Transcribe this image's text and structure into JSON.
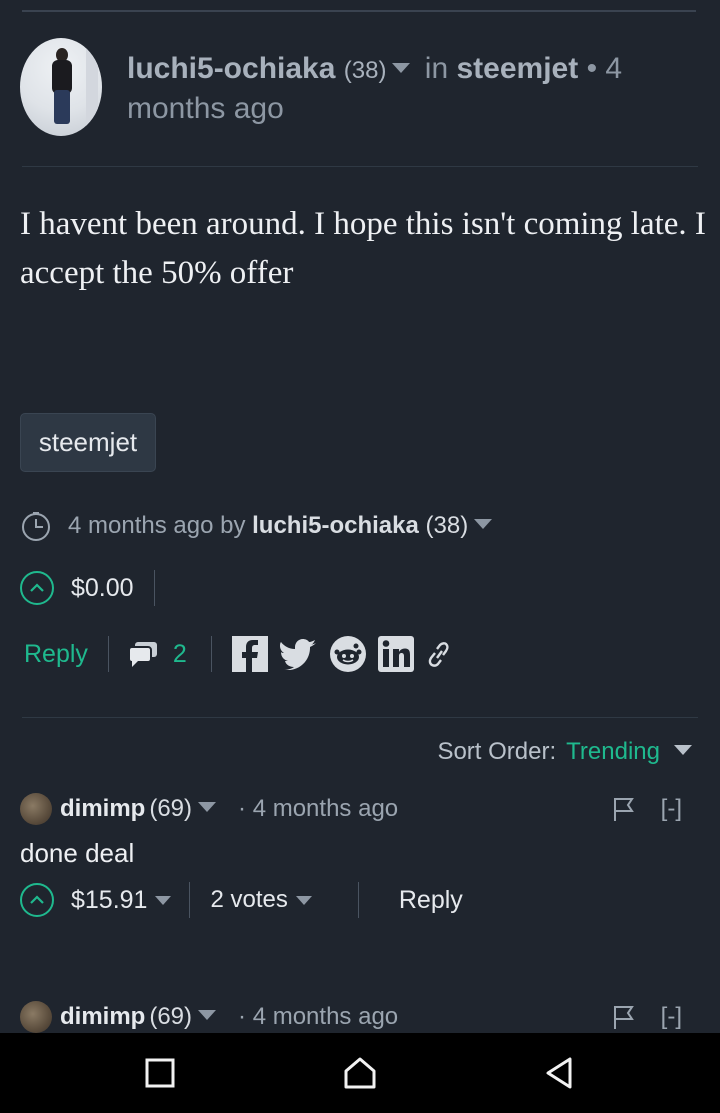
{
  "post": {
    "author": "luchi5-ochiaka",
    "reputation": "(38)",
    "in_label": "in",
    "community": "steemjet",
    "separator": "•",
    "time": "4 months ago",
    "body": "I havent been around. I hope this isn't coming late. I accept the 50% offer",
    "tag": "steemjet",
    "meta_time": "4 months ago by",
    "payout": "$0.00",
    "reply_label": "Reply",
    "comment_count": "2"
  },
  "sort": {
    "label": "Sort Order:",
    "value": "Trending"
  },
  "comments": [
    {
      "author": "dimimp",
      "reputation": "(69)",
      "separator": "·",
      "time": "4 months ago",
      "collapse": "[-]",
      "body": "done deal",
      "payout": "$15.91",
      "votes": "2 votes",
      "reply_label": "Reply"
    },
    {
      "author": "dimimp",
      "reputation": "(69)",
      "separator": "·",
      "time": "4 months ago",
      "collapse": "[-]"
    }
  ],
  "icons": {
    "accent_color": "#1fb98e",
    "background_color": "#1f252e"
  }
}
